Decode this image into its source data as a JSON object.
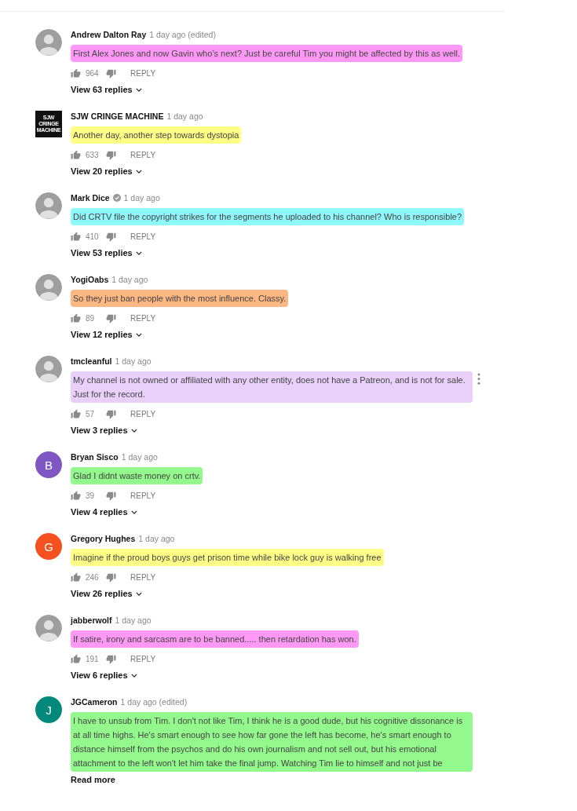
{
  "comments": [
    {
      "author": "Andrew Dalton Ray",
      "time": "1 day ago (edited)",
      "verified": false,
      "menu": false,
      "avatar": {
        "kind": "photo"
      },
      "text": "First Alex Jones and now Gavin who’s next? Just be careful Tim you might be affected by this as well.",
      "color": "#ff99f5",
      "likes": "964",
      "reply": "REPLY",
      "replies": "View 63 replies"
    },
    {
      "author": "SJW CRINGE MACHINE",
      "time": "1 day ago",
      "verified": false,
      "menu": false,
      "avatar": {
        "kind": "logo",
        "lines": [
          "SJW",
          "CRINGE",
          "MACHINE"
        ]
      },
      "text": "Another day, another step towards dystopia",
      "color": "#ffff88",
      "likes": "633",
      "reply": "REPLY",
      "replies": "View 20 replies"
    },
    {
      "author": "Mark Dice",
      "time": "1 day ago",
      "verified": true,
      "menu": false,
      "avatar": {
        "kind": "photo"
      },
      "text": "Did CRTV file the copyright strikes for the segments he uploaded to his channel?  Who is responsible?",
      "color": "#8ff8fb",
      "likes": "410",
      "reply": "REPLY",
      "replies": "View 53 replies"
    },
    {
      "author": "YogiOabs",
      "time": "1 day ago",
      "verified": false,
      "menu": false,
      "avatar": {
        "kind": "photo"
      },
      "text": "So they just ban people with the most influence. Classy.",
      "color": "#ffb784",
      "likes": "89",
      "reply": "REPLY",
      "replies": "View 12 replies"
    },
    {
      "author": "tmcleanful",
      "time": "1 day ago",
      "verified": false,
      "menu": true,
      "avatar": {
        "kind": "photo"
      },
      "text": "My channel is not owned or affiliated with any other entity, does not have a Patreon, and is not for sale. Just for the record.",
      "color": "#e8d0fb",
      "likes": "57",
      "reply": "REPLY",
      "replies": "View 3 replies"
    },
    {
      "author": "Bryan Sisco",
      "time": "1 day ago",
      "verified": false,
      "menu": false,
      "avatar": {
        "kind": "letter",
        "letter": "B",
        "color": "#7e57c2"
      },
      "text": "Glad I didnt waste money on crtv.",
      "color": "#94f98c",
      "likes": "39",
      "reply": "REPLY",
      "replies": "View 4 replies"
    },
    {
      "author": "Gregory Hughes",
      "time": "1 day ago",
      "verified": false,
      "menu": false,
      "avatar": {
        "kind": "letter",
        "letter": "G",
        "color": "#f4511e"
      },
      "text": "Imagine if the proud boys guys get prison time while bike lock guy is walking free",
      "color": "#ffff88",
      "likes": "246",
      "reply": "REPLY",
      "replies": "View 26 replies"
    },
    {
      "author": "jabberwolf",
      "time": "1 day ago",
      "verified": false,
      "menu": false,
      "avatar": {
        "kind": "photo"
      },
      "text": "If satire, irony and sarcasm are to be banned..... then retardation has won.",
      "color": "#ff99f5",
      "likes": "191",
      "reply": "REPLY",
      "replies": "View 6 replies"
    },
    {
      "author": "JGCameron",
      "time": "1 day ago (edited)",
      "verified": false,
      "menu": false,
      "avatar": {
        "kind": "letter",
        "letter": "J",
        "color": "#00897b"
      },
      "text": "I have to unsub from Tim. I don't not like Tim, I think he is a good dude, but his cognitive dissonance is at all time highs. He's smart enough to see how far gone the left has become, he's smart enough to distance himself from the psychos and do his own journalism and not sell out, but his emotional attachment to the left won't let him take the final jump. Watching Tim lie to himself and not just be",
      "color": "#94f98c",
      "read_more": "Read more"
    }
  ]
}
